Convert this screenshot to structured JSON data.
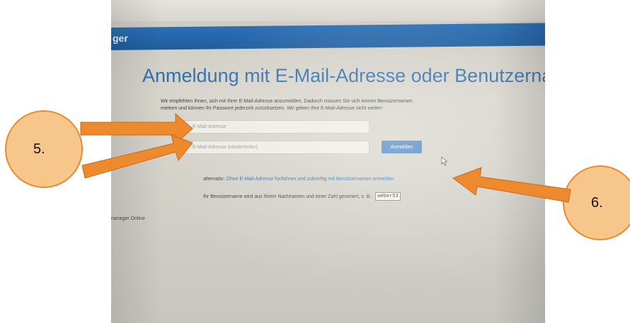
{
  "app": {
    "brand_fragment": "ger",
    "footer_fragment": "nanager Online"
  },
  "page": {
    "title": "Anmeldung mit E-Mail-Adresse oder Benutzername",
    "intro_line1": "Wir empfehlen Ihnen, sich mit Ihrer E-Mail-Adresse anzumelden. Dadurch müssen Sie sich keinen Benutzernamen",
    "intro_line2": "merken und können Ihr Passwort jederzeit zurücksetzen. Wir geben Ihre E-Mail-Adresse nicht weiter!"
  },
  "form": {
    "email_placeholder": "E-Mail-Adresse",
    "email_repeat_placeholder": "E-Mail-Adresse (wiederholen)",
    "submit_label": "Anmelden"
  },
  "alternative": {
    "prefix": "alternativ:",
    "link_text": "Ohne E-Mail-Adresse fortfahren und zukünftig mit Benutzernamen anmelden",
    "username_info": "Ihr Benutzername wird aus Ihrem Nachnamen und einer Zahl generiert, z. B.:",
    "username_example": "weber53"
  },
  "annotations": {
    "left_marker": "5.",
    "right_marker": "6."
  },
  "colors": {
    "header_blue": "#1f5d9f",
    "title_blue": "#2e6fae",
    "button_blue": "#3f7fbf",
    "annotation_orange": "#ee8a2e",
    "annotation_fill": "#f6c68a"
  },
  "icons": {
    "cursor": "mouse-pointer-icon"
  }
}
